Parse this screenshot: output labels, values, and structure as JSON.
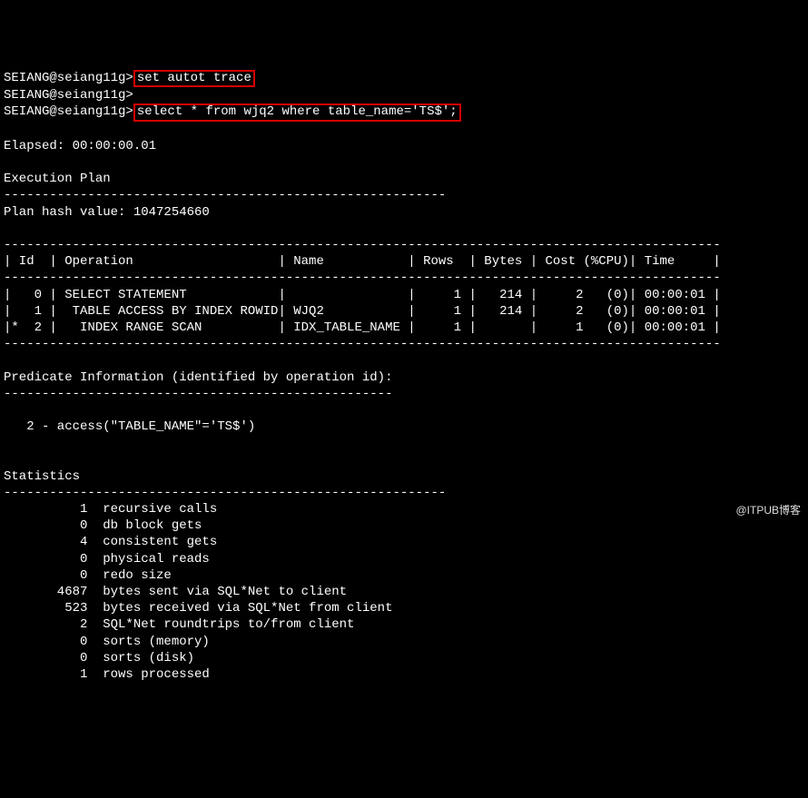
{
  "prompt": "SEIANG@seiang11g>",
  "cmd1": "set autot trace",
  "cmd2": "select * from wjq2 where table_name='TS$';",
  "elapsed_label": "Elapsed: 00:00:00.01",
  "exec_plan_label": "Execution Plan",
  "dash60": "----------------------------------------------------------",
  "plan_hash_label": "Plan hash value: 1047254660",
  "plan_border": "----------------------------------------------------------------------------------------------",
  "plan_header": "| Id  | Operation                   | Name           | Rows  | Bytes | Cost (%CPU)| Time     |",
  "plan_rows": [
    "|   0 | SELECT STATEMENT            |                |     1 |   214 |     2   (0)| 00:00:01 |",
    "|   1 |  TABLE ACCESS BY INDEX ROWID| WJQ2           |     1 |   214 |     2   (0)| 00:00:01 |",
    "|*  2 |   INDEX RANGE SCAN          | IDX_TABLE_NAME |     1 |       |     1   (0)| 00:00:01 |"
  ],
  "pred_label": "Predicate Information (identified by operation id):",
  "pred_dash": "---------------------------------------------------",
  "pred_line": "   2 - access(\"TABLE_NAME\"='TS$')",
  "stats_label": "Statistics",
  "stats": [
    "          1  recursive calls",
    "          0  db block gets",
    "          4  consistent gets",
    "          0  physical reads",
    "          0  redo size",
    "       4687  bytes sent via SQL*Net to client",
    "        523  bytes received via SQL*Net from client",
    "          2  SQL*Net roundtrips to/from client",
    "          0  sorts (memory)",
    "          0  sorts (disk)",
    "          1  rows processed"
  ],
  "watermark": "@ITPUB博客",
  "chart_data": {
    "type": "table",
    "title": "Execution Plan",
    "plan_hash_value": 1047254660,
    "columns": [
      "Id",
      "Operation",
      "Name",
      "Rows",
      "Bytes",
      "Cost (%CPU)",
      "Time"
    ],
    "rows": [
      {
        "Id": 0,
        "Operation": "SELECT STATEMENT",
        "Name": "",
        "Rows": 1,
        "Bytes": 214,
        "Cost": 2,
        "%CPU": 0,
        "Time": "00:00:01"
      },
      {
        "Id": 1,
        "Operation": "TABLE ACCESS BY INDEX ROWID",
        "Name": "WJQ2",
        "Rows": 1,
        "Bytes": 214,
        "Cost": 2,
        "%CPU": 0,
        "Time": "00:00:01"
      },
      {
        "Id": 2,
        "filter_predicate": true,
        "Operation": "INDEX RANGE SCAN",
        "Name": "IDX_TABLE_NAME",
        "Rows": 1,
        "Bytes": null,
        "Cost": 1,
        "%CPU": 0,
        "Time": "00:00:01"
      }
    ],
    "predicates": [
      {
        "id": 2,
        "type": "access",
        "expr": "\"TABLE_NAME\"='TS$'"
      }
    ],
    "statistics": {
      "recursive_calls": 1,
      "db_block_gets": 0,
      "consistent_gets": 4,
      "physical_reads": 0,
      "redo_size": 0,
      "bytes_sent_sqlnet": 4687,
      "bytes_received_sqlnet": 523,
      "sqlnet_roundtrips": 2,
      "sorts_memory": 0,
      "sorts_disk": 0,
      "rows_processed": 1
    },
    "elapsed": "00:00:00.01"
  }
}
